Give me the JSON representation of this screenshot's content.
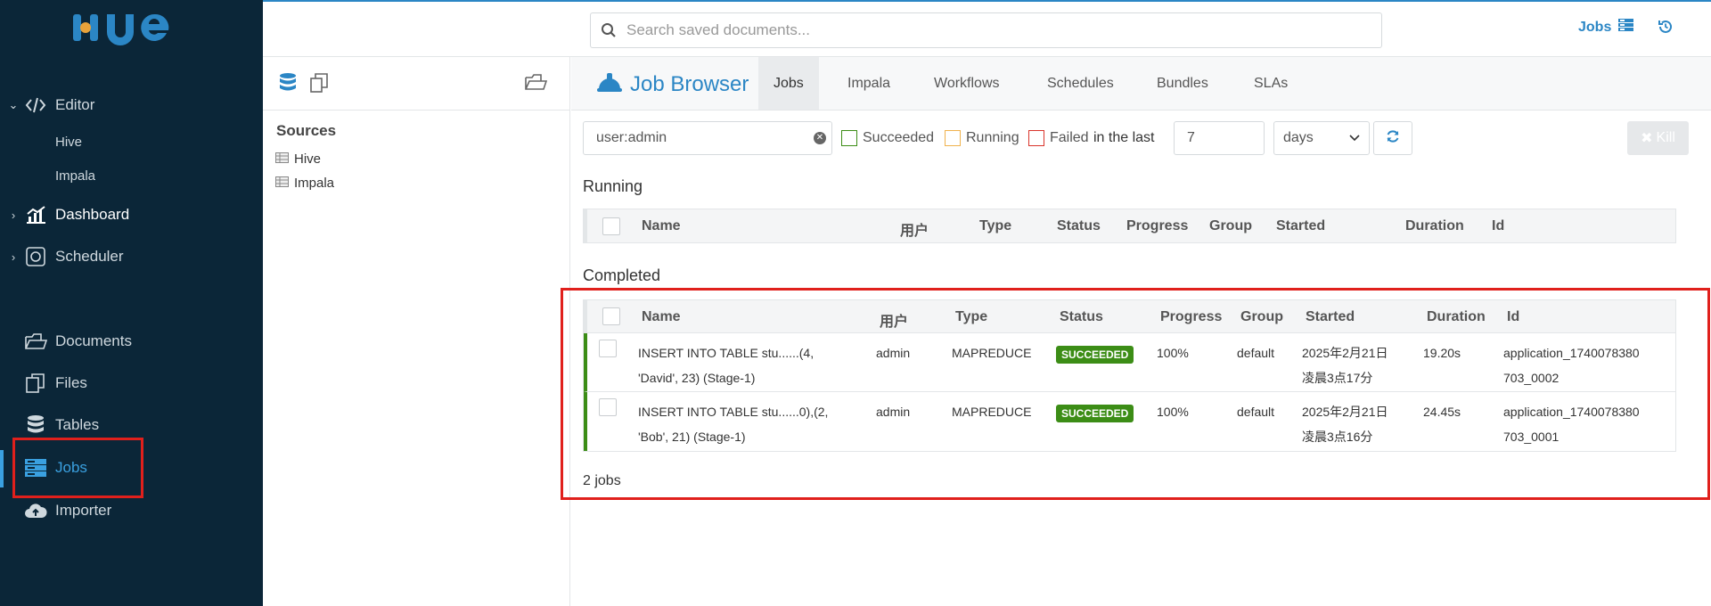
{
  "app": {
    "logo_text": "HUE"
  },
  "leftnav": {
    "editor": {
      "label": "Editor",
      "subitems": [
        "Hive",
        "Impala"
      ]
    },
    "dashboard": {
      "label": "Dashboard"
    },
    "scheduler": {
      "label": "Scheduler"
    },
    "documents": {
      "label": "Documents"
    },
    "files": {
      "label": "Files"
    },
    "tables": {
      "label": "Tables"
    },
    "jobs": {
      "label": "Jobs"
    },
    "importer": {
      "label": "Importer"
    }
  },
  "topbar": {
    "search_placeholder": "Search saved documents...",
    "jobs_label": "Jobs"
  },
  "assist": {
    "sources_title": "Sources",
    "sources": [
      "Hive",
      "Impala"
    ]
  },
  "main": {
    "title": "Job Browser",
    "tabs": [
      "Jobs",
      "Impala",
      "Workflows",
      "Schedules",
      "Bundles",
      "SLAs"
    ],
    "filters": {
      "user_value": "user:admin",
      "succeeded": "Succeeded",
      "running": "Running",
      "failed": "Failed",
      "in_the_last": "in the last",
      "days_value": "7",
      "unit_value": "days",
      "kill_label": "Kill"
    },
    "running_title": "Running",
    "completed_title": "Completed",
    "columns": [
      "Name",
      "用户",
      "Type",
      "Status",
      "Progress",
      "Group",
      "Started",
      "Duration",
      "Id"
    ],
    "jobs": [
      {
        "name_line1": "INSERT INTO TABLE stu......(4,",
        "name_line2": "'David', 23) (Stage-1)",
        "user": "admin",
        "type": "MAPREDUCE",
        "status": "SUCCEEDED",
        "progress": "100%",
        "group": "default",
        "started_line1": "2025年2月21日",
        "started_line2": "凌晨3点17分",
        "duration": "19.20s",
        "id_line1": "application_1740078380",
        "id_line2": "703_0002"
      },
      {
        "name_line1": "INSERT INTO TABLE stu......0),(2,",
        "name_line2": "'Bob', 21) (Stage-1)",
        "user": "admin",
        "type": "MAPREDUCE",
        "status": "SUCCEEDED",
        "progress": "100%",
        "group": "default",
        "started_line1": "2025年2月21日",
        "started_line2": "凌晨3点16分",
        "duration": "24.45s",
        "id_line1": "application_1740078380",
        "id_line2": "703_0001"
      }
    ],
    "jobs_count": "2 jobs"
  },
  "colors": {
    "sidebar_bg": "#0b2638",
    "accent": "#2b86c5",
    "success": "#3c8d16",
    "highlight": "#e0201c"
  }
}
